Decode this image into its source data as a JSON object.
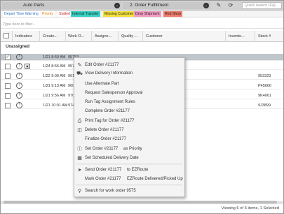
{
  "toolbar": {
    "view_select": "Auto Parts",
    "order_select": "2. Order Fulfillment",
    "search_placeholder": "Quick search (F4)..."
  },
  "legend": [
    {
      "label": "Depart Time Warning",
      "color": "#2f6fc0",
      "bg": "#ffffff"
    },
    {
      "label": "Priority",
      "color": "#e07a00",
      "bg": "#ffffff"
    },
    {
      "label": "Stalled",
      "color": "#d21f1f",
      "bg": "#ffffff"
    },
    {
      "label": "Internal Transfer",
      "color": "#222222",
      "bg": "#34d1c1"
    },
    {
      "label": "Missing Customer",
      "color": "#222222",
      "bg": "#f3e13a"
    },
    {
      "label": "Drop Shipment",
      "color": "#222222",
      "bg": "#f49ac2"
    },
    {
      "label": "Red Shop",
      "color": "#222222",
      "bg": "#f07a6a"
    }
  ],
  "filter_placeholder": "Type here to filter...",
  "columns": [
    "Indicators",
    "Create...",
    "Work O...",
    "Assigne...",
    "Quality ...",
    "Customer",
    "Invento...",
    "Stock #"
  ],
  "group_label": "Unassigned",
  "rows": [
    {
      "created": "1/21 8:50 AM",
      "work_order": "95753",
      "stock": "",
      "selected": true
    },
    {
      "created": "1/24 8:56 AM",
      "work_order": "957",
      "stock": "",
      "selected": false
    },
    {
      "created": "1/22 9:00 AM",
      "work_order": "961",
      "stock": "953323",
      "selected": false
    },
    {
      "created": "1/21 9:13 AM",
      "work_order": "960",
      "stock": "P45660",
      "selected": false
    },
    {
      "created": "1/21 9:56 AM",
      "work_order": "970",
      "stock": "9K4061",
      "selected": false
    },
    {
      "created": "1/21 10:01 AM",
      "work_order": "974",
      "stock": "9J3899",
      "selected": false
    }
  ],
  "context_menu": {
    "edit": "Edit Order #21177",
    "view_delivery": "View Delivery Information",
    "alternate": "Use Alternate Part",
    "approval": "Request Salesperson Approval",
    "tag_rules": "Run Tag Assignment Rules",
    "complete": "Complete Order #21177",
    "print_tag": "Print Tag for Order #21177",
    "delete": "Delete Order #21177",
    "finalize": "Finalize Order #21177",
    "set_order": "Set Order #21177",
    "as_priority": "as Priority",
    "scheduled": "Set Scheduled Delivery Date",
    "send_order": "Send Order #21177",
    "to_ezroute": "to EZRoute",
    "mark_order": "Mark Order #21177",
    "ezroute_delivered": "EZRoute Delivered/Picked Up",
    "search": "Search for work order 9575"
  },
  "status_text": "Viewing 6 of 6 items, 1 Selected"
}
